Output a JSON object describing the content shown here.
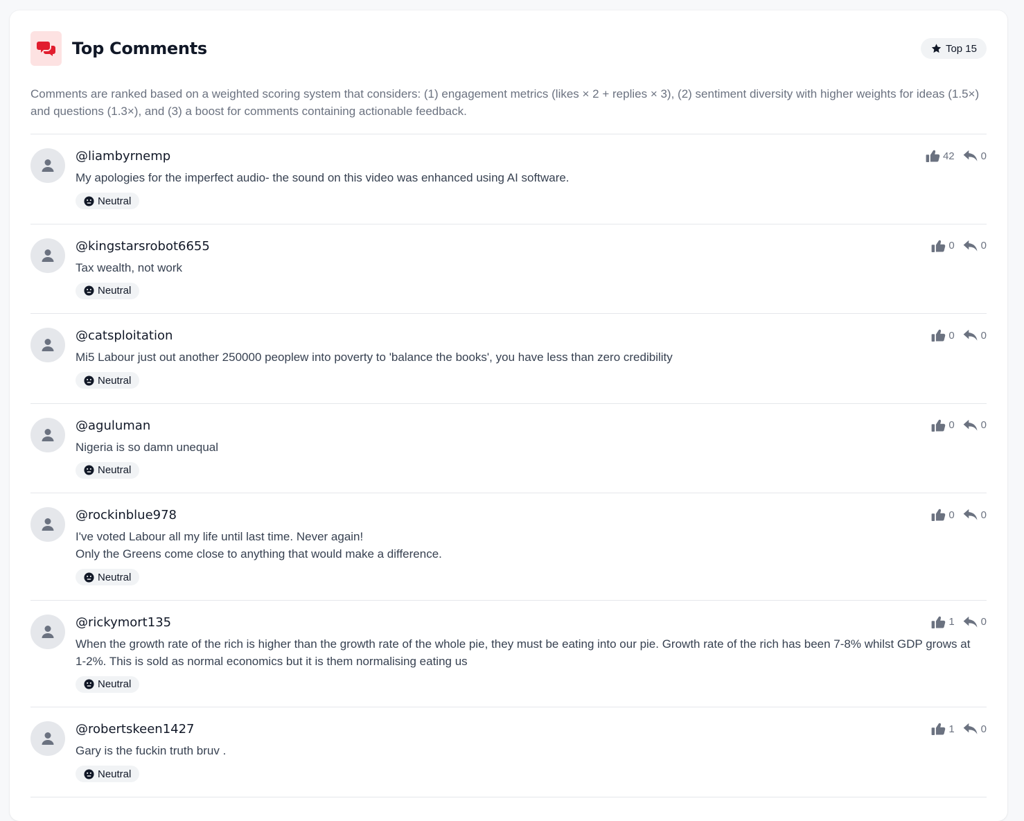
{
  "header": {
    "title": "Top Comments",
    "icon": "comments-icon",
    "accent_color": "#e11d2e",
    "badge_label": "Top 15"
  },
  "description": "Comments are ranked based on a weighted scoring system that considers: (1) engagement metrics (likes × 2 + replies × 3), (2) sentiment diversity with higher weights for ideas (1.5×) and questions (1.3×), and (3) a boost for comments containing actionable feedback.",
  "comments": [
    {
      "username": "@liambyrnemp",
      "text": "My apologies for the imperfect audio- the sound on this video was enhanced using AI software.",
      "sentiment": "Neutral",
      "likes": "42",
      "replies": "0"
    },
    {
      "username": "@kingstarsrobot6655",
      "text": "Tax wealth, not work",
      "sentiment": "Neutral",
      "likes": "0",
      "replies": "0"
    },
    {
      "username": "@catsploitation",
      "text": "Mi5 Labour just out another 250000 peoplew into poverty to 'balance the books', you have less than zero credibility",
      "sentiment": "Neutral",
      "likes": "0",
      "replies": "0"
    },
    {
      "username": "@aguluman",
      "text": "Nigeria is so damn unequal",
      "sentiment": "Neutral",
      "likes": "0",
      "replies": "0"
    },
    {
      "username": "@rockinblue978",
      "text": "I've voted Labour all my life until last time. Never again!\nOnly the Greens come close to anything that would make a difference.",
      "sentiment": "Neutral",
      "likes": "0",
      "replies": "0"
    },
    {
      "username": "@rickymort135",
      "text": "When the growth rate of the rich is higher than the growth rate of the whole pie, they must be eating into our pie. Growth rate of the rich has been 7-8% whilst GDP grows at 1-2%. This is sold as normal economics but it is them normalising eating us",
      "sentiment": "Neutral",
      "likes": "1",
      "replies": "0"
    },
    {
      "username": "@robertskeen1427",
      "text": "Gary is the fuckin truth bruv .",
      "sentiment": "Neutral",
      "likes": "1",
      "replies": "0"
    }
  ]
}
